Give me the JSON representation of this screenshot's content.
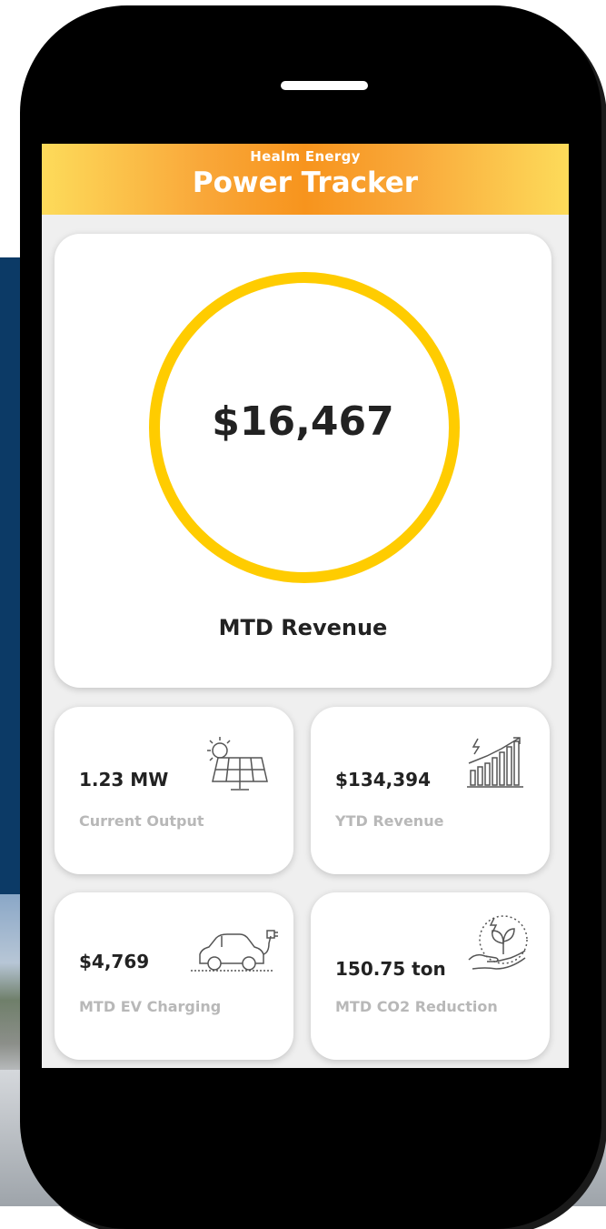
{
  "header": {
    "brand": "Healm Energy",
    "title": "Power Tracker"
  },
  "main_card": {
    "value": "$16,467",
    "label": "MTD Revenue"
  },
  "stats": [
    {
      "value": "1.23 MW",
      "label": "Current Output",
      "icon": "solar-panel-icon"
    },
    {
      "value": "$134,394",
      "label": "YTD Revenue",
      "icon": "growth-chart-icon"
    },
    {
      "value": "$4,769",
      "label": "MTD EV Charging",
      "icon": "ev-car-charging-icon"
    },
    {
      "value": "150.75 ton",
      "label": "MTD CO2 Reduction",
      "icon": "plant-hand-icon"
    }
  ],
  "colors": {
    "accent": "#ffcc00",
    "header_start": "#fddb5a",
    "header_mid": "#f7941d",
    "background_band": "#0c3a66"
  }
}
